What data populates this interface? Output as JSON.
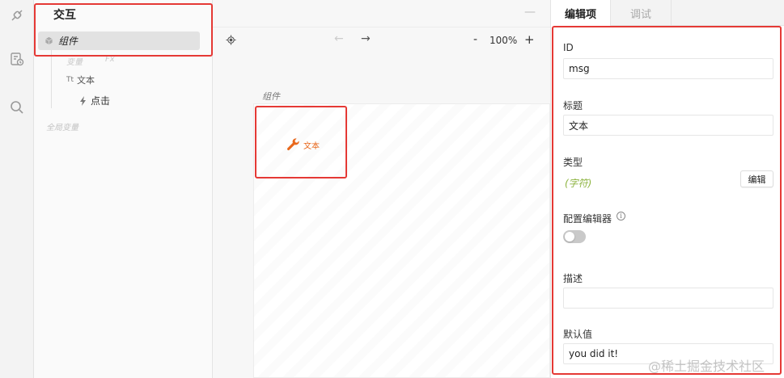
{
  "outline": {
    "title": "交互",
    "component_label": "组件",
    "variable_label": "变量",
    "fx_label": "Fx",
    "text_prefix": "Tt",
    "text_label": "文本",
    "click_label": "点击",
    "global_var_label": "全局变量"
  },
  "canvas": {
    "zoom": "100%",
    "zoom_out": "-",
    "zoom_in": "+",
    "frame_label": "组件",
    "widget_label": "文本"
  },
  "props": {
    "tab_edit": "编辑项",
    "tab_debug": "调试",
    "id_label": "ID",
    "id_value": "msg",
    "title_label": "标题",
    "title_value": "文本",
    "type_label": "类型",
    "type_value": "(字符)",
    "edit_button": "编辑",
    "config_editor_label": "配置编辑器",
    "info_glyph": "i",
    "desc_label": "描述",
    "desc_value": "",
    "default_label": "默认值",
    "default_value": "you did it!"
  },
  "watermark": "@稀土掘金技术社区",
  "colors": {
    "accent": "#e8671b",
    "highlight_border": "#e53935",
    "type_value": "#8cb33f"
  },
  "toggle_on": false
}
